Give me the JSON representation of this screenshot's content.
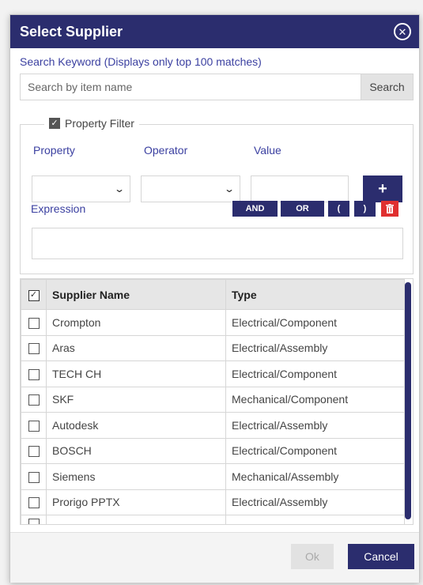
{
  "dialog": {
    "title": "Select Supplier"
  },
  "search": {
    "label": "Search Keyword (Displays only top 100 matches)",
    "placeholder": "Search by item name",
    "button_label": "Search"
  },
  "filter": {
    "legend_label": "Property Filter",
    "checked": true,
    "property_label": "Property",
    "operator_label": "Operator",
    "value_label": "Value",
    "add_button": "+",
    "expression_label": "Expression",
    "operators": [
      "AND",
      "OR",
      "(",
      ")"
    ]
  },
  "table": {
    "headers": [
      "Supplier Name",
      "Type"
    ],
    "rows": [
      {
        "name": "Crompton",
        "type": "Electrical/Component"
      },
      {
        "name": "Aras",
        "type": "Electrical/Assembly"
      },
      {
        "name": "TECH CH",
        "type": "Electrical/Component"
      },
      {
        "name": "SKF",
        "type": "Mechanical/Component"
      },
      {
        "name": "Autodesk",
        "type": "Electrical/Assembly"
      },
      {
        "name": "BOSCH",
        "type": "Electrical/Component"
      },
      {
        "name": "Siemens",
        "type": "Mechanical/Assembly"
      },
      {
        "name": "Prorigo PPTX",
        "type": "Electrical/Assembly"
      }
    ]
  },
  "footer": {
    "ok_label": "Ok",
    "cancel_label": "Cancel"
  },
  "colors": {
    "accent": "#2b2d6e",
    "label": "#3a3fa0",
    "delete": "#e03030"
  }
}
